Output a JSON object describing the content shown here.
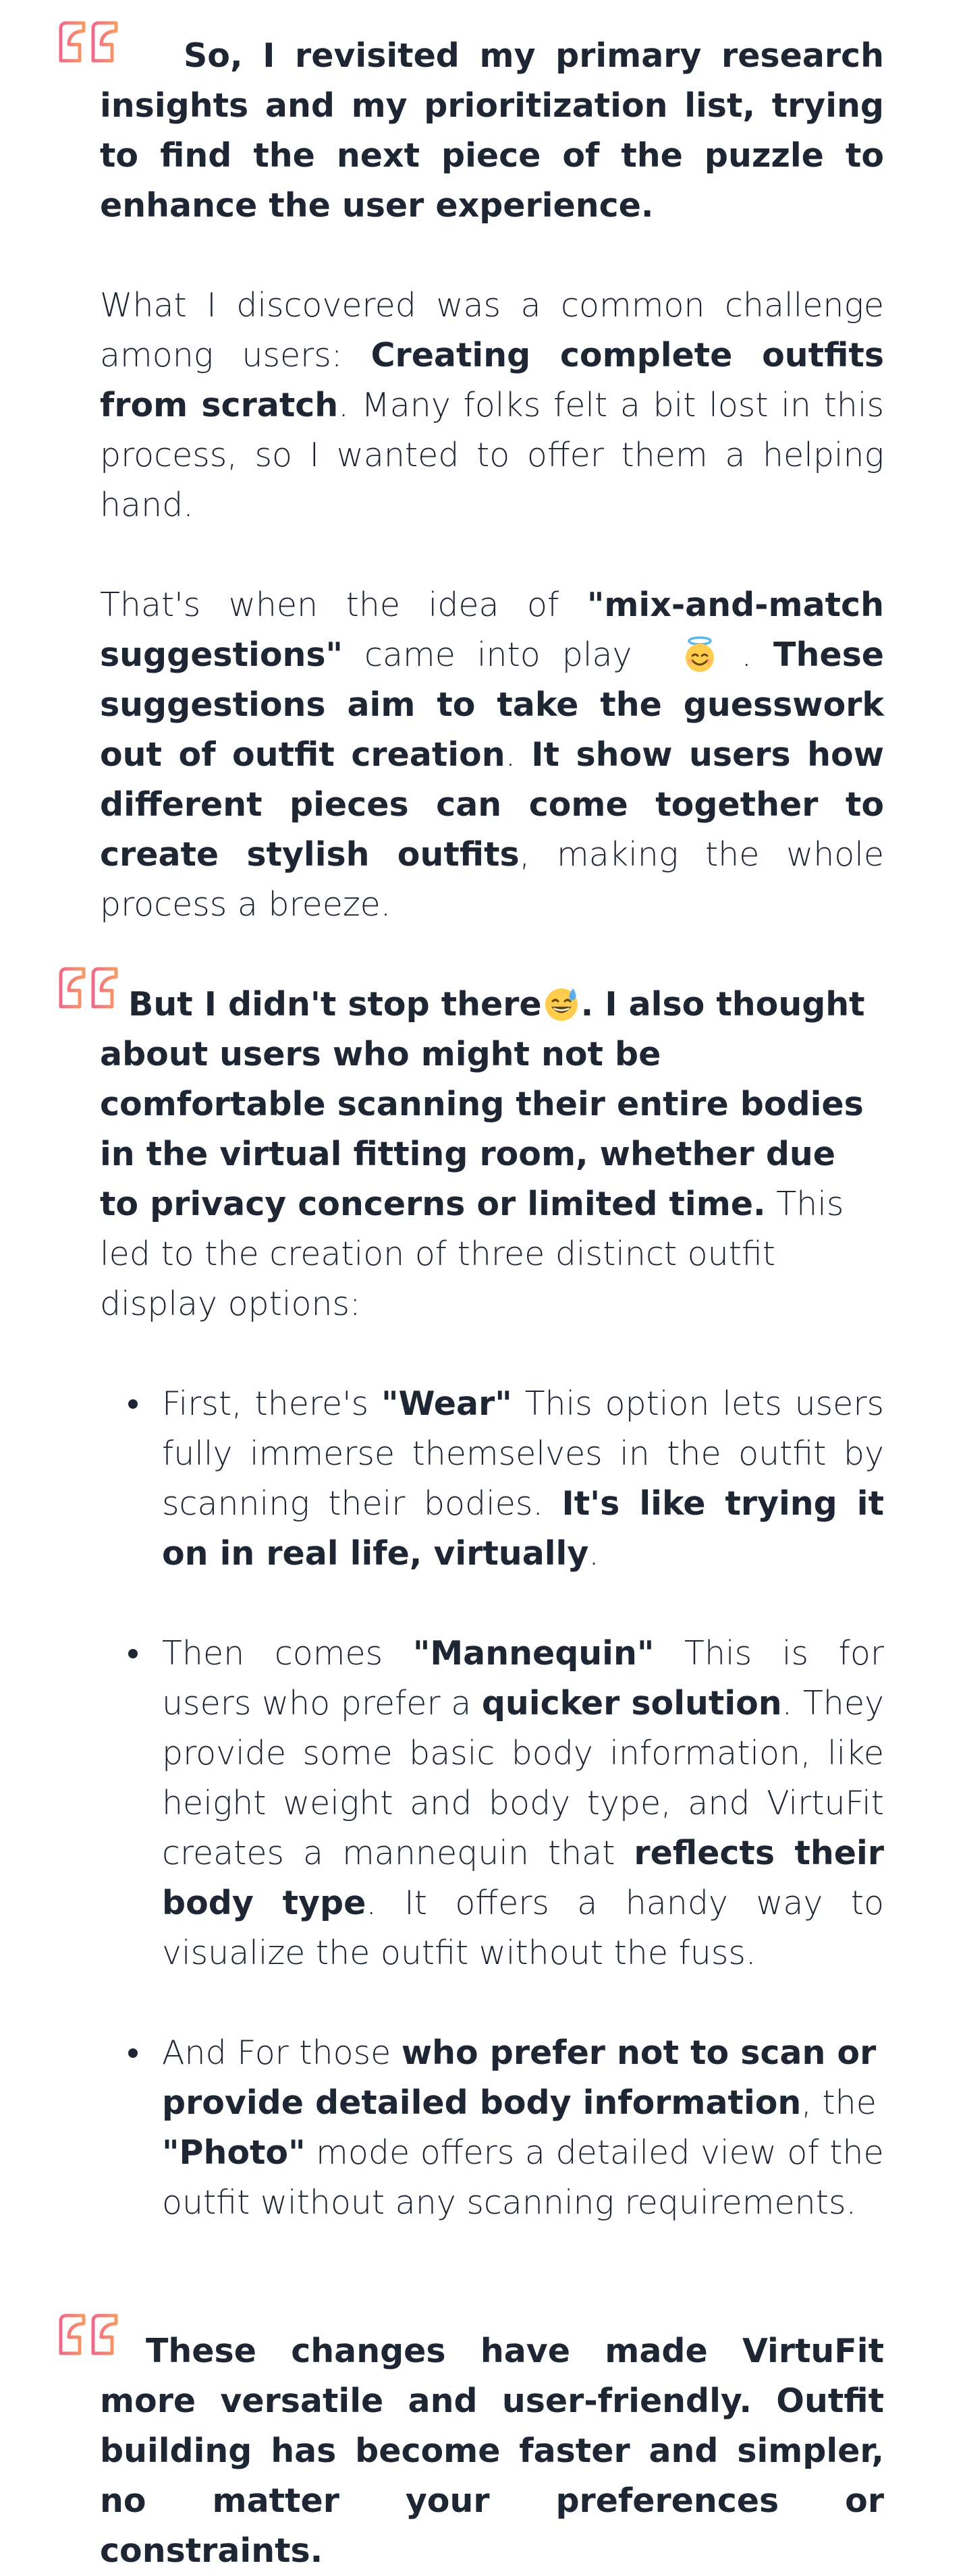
{
  "section1": {
    "lead": "So, I revisited my primary research insights and my prioritization list, trying to find the next piece of the puzzle to enhance the user experience.",
    "p2_start": "What I discovered was a common challenge among users: ",
    "p2_bold": "Creating complete outfits from scratch",
    "p2_end": ". Many folks felt a bit lost in this process, so I wanted to offer them a helping hand.",
    "p3_start": "That's when the idea of ",
    "p3_bold1": "\"mix-and-match suggestions\"",
    "p3_mid1": " came into play ",
    "p3_after_emoji": " . ",
    "p3_bold2": "These suggestions aim to take the guesswork out of outfit creation",
    "p3_mid2": ". ",
    "p3_bold3": "It show users how different pieces can come together to create stylish outfits",
    "p3_end": ", making the whole process a breeze."
  },
  "section2": {
    "lead_bold1": "But I didn't stop there",
    "lead_bold2": ". I also thought about users who might not be comfortable scanning their entire bodies in the virtual fitting room, whether due to privacy concerns or limited time.",
    "lead_end": " This led to the creation of three distinct outfit display options:",
    "items": [
      {
        "start": "First, there's ",
        "bold1": "\"Wear\"",
        "mid": " This option lets users fully immerse themselves in the outfit by scanning their bodies. ",
        "bold2": "It's like trying it on in real life, virtually",
        "end": "."
      },
      {
        "start": "Then comes ",
        "bold1": "\"Mannequin\"",
        "mid1": " This is for users who prefer a ",
        "bold2": "quicker solution",
        "mid2": ". They provide some basic body information, like height weight and body type, and VirtuFit creates a mannequin that ",
        "bold3": "reflects their body type",
        "end": ". It offers a handy way to visualize the outfit without the fuss."
      },
      {
        "start": "And For those ",
        "bold1": "who prefer not to scan or provide detailed body information",
        "mid": ", the ",
        "bold2": "\"Photo\"",
        "end": " mode offers a detailed view of the outfit without any scanning requirements."
      }
    ]
  },
  "section3": {
    "lead": "These changes have made VirtuFit more versatile and user-friendly. Outfit building has become faster and simpler, no matter your preferences or constraints."
  },
  "icons": {
    "quote": "quote-icon",
    "halo_emoji": "smiling-face-with-halo-icon",
    "sweat_emoji": "grinning-face-with-sweat-icon"
  },
  "colors": {
    "quote_start": "#f06a8a",
    "quote_end": "#f59a62",
    "text": "#1f2633"
  }
}
